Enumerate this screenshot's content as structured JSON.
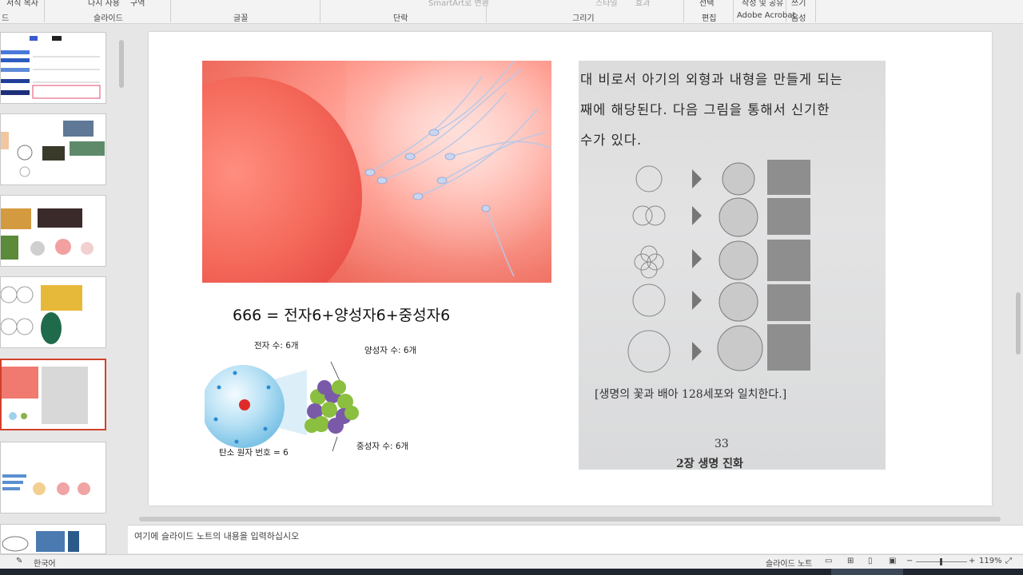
{
  "ribbon": {
    "top_labels": [
      "서식 복사",
      "다시 사용",
      "구역",
      "SmartArt로 변환",
      "스타일",
      "효과",
      "선택",
      "작성 및 공유",
      "쓰기"
    ],
    "groups": [
      "드",
      "슬라이드",
      "글꼴",
      "단락",
      "그리기",
      "편집",
      "Adobe Acrobat",
      "음성"
    ]
  },
  "slide": {
    "formula": "666 = 전자6+양성자6+중성자6",
    "atom": {
      "electrons_label": "전자 수: 6개",
      "protons_label": "양성자 수: 6개",
      "neutrons_label": "중성자 수: 6개",
      "atomic_number_label": "탄소 원자 번호 = 6"
    },
    "book": {
      "lines": [
        "대 비로서 아기의 외형과 내형을 만들게 되는",
        "째에 해당된다. 다음 그림을 통해서 신기한",
        "수가 있다."
      ],
      "caption": "[생명의 꽃과 배아 128세포와 일치한다.]",
      "page_number": "33",
      "chapter": "2장 생명 진화"
    }
  },
  "notes": {
    "placeholder": "여기에 슬라이드 노트의 내용을 입력하십시오"
  },
  "status": {
    "language": "한국어",
    "slide_notes": "슬라이드 노트",
    "zoom": "119%"
  }
}
